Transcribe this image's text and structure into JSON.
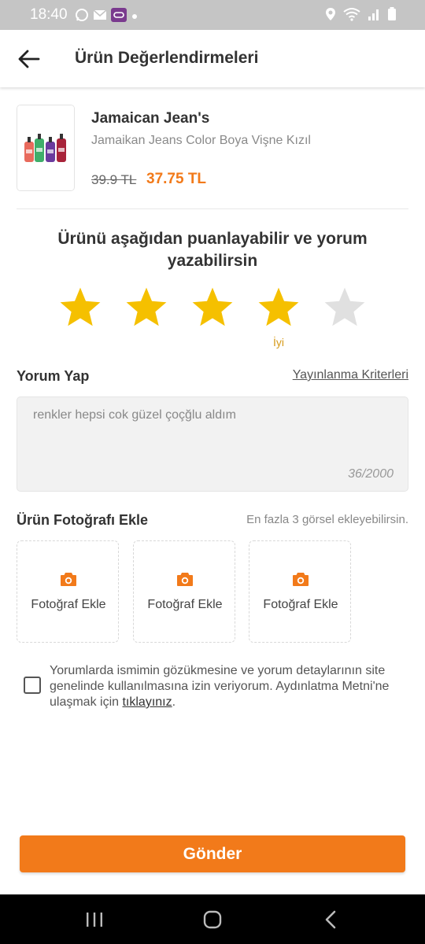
{
  "status_bar": {
    "time": "18:40",
    "left_icons": [
      "whatsapp-icon",
      "mail-icon",
      "app-notification-icon",
      "dot-icon"
    ],
    "right_icons": [
      "location-icon",
      "wifi-icon",
      "signal-icon",
      "battery-icon"
    ]
  },
  "app_bar": {
    "title": "Ürün Değerlendirmeleri",
    "back_icon": "arrow-left-icon"
  },
  "product": {
    "brand": "Jamaican Jean's",
    "name": "Jamaikan Jeans Color Boya Vişne Kızıl",
    "old_price": "39.9 TL",
    "new_price": "37.75 TL"
  },
  "rating": {
    "prompt": "Ürünü aşağıdan puanlayabilir ve yorum yazabilirsin",
    "value": 4,
    "max": 5,
    "label": "İyi",
    "filled_color": "#f5c000",
    "empty_color": "#e0e0e0"
  },
  "comment": {
    "section_title": "Yorum Yap",
    "criteria_link": "Yayınlanma Kriterleri",
    "text": "renkler hepsi cok güzel çoçğlu aldım",
    "counter": "36/2000"
  },
  "photos": {
    "section_title": "Ürün Fotoğrafı Ekle",
    "hint": "En fazla 3 görsel ekleyebilirsin.",
    "slots": [
      {
        "label": "Fotoğraf Ekle"
      },
      {
        "label": "Fotoğraf Ekle"
      },
      {
        "label": "Fotoğraf Ekle"
      }
    ]
  },
  "consent": {
    "checked": false,
    "text": "Yorumlarda ismimin gözükmesine ve yorum detaylarının site genelinde kullanılmasına izin veriyorum. Aydınlatma Metni'ne ulaşmak için ",
    "link": "tıklayınız",
    "suffix": "."
  },
  "submit": {
    "label": "Gönder"
  },
  "colors": {
    "accent": "#f27a1a",
    "star": "#f5c000"
  }
}
